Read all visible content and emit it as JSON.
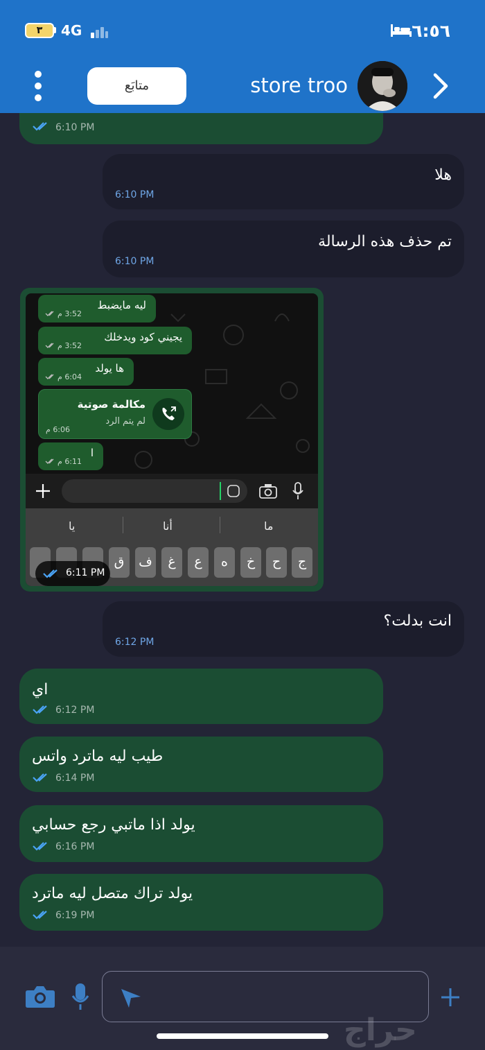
{
  "status_bar": {
    "time": "٦:٥٦",
    "network": "4G",
    "battery": "٣"
  },
  "header": {
    "follow_label": "متابَع",
    "contact_name": "store troo"
  },
  "messages": [
    {
      "dir": "out",
      "text": "",
      "time": "6:10 PM"
    },
    {
      "dir": "in",
      "text": "هلا",
      "time": "6:10 PM"
    },
    {
      "dir": "in",
      "text": "تم حذف هذه الرسالة",
      "time": "6:10 PM"
    },
    {
      "dir": "in",
      "text": "انت بدلت؟",
      "time": "6:12 PM"
    },
    {
      "dir": "out",
      "text": "اي",
      "time": "6:12 PM"
    },
    {
      "dir": "out",
      "text": "طيب ليه ماترد واتس",
      "time": "6:14 PM"
    },
    {
      "dir": "out",
      "text": "يولد اذا ماتبي رجع حسابي",
      "time": "6:16 PM"
    },
    {
      "dir": "out",
      "text": "يولد تراك متصل ليه ماترد",
      "time": "6:19 PM"
    }
  ],
  "image_message": {
    "time": "6:11 PM",
    "screenshot": {
      "messages": [
        {
          "text": "ليه مايضبط",
          "time": "3:52 م"
        },
        {
          "text": "يجيني كود ويدخلك",
          "time": "3:52 م"
        },
        {
          "text": "ها يولد",
          "time": "6:04 م"
        },
        {
          "text": "ا",
          "time": "6:11 م"
        }
      ],
      "call": {
        "title": "مكالمة صوتية",
        "subtitle": "لم يتم الرد",
        "time": "6:06 م"
      },
      "suggestions": [
        "ما",
        "أنا",
        "يا"
      ],
      "keys": [
        "ج",
        "ح",
        "خ",
        "ه",
        "ع",
        "غ",
        "ف",
        "ق"
      ]
    }
  },
  "watermark": "حراج",
  "colors": {
    "header": "#1f73c9",
    "background": "#232436",
    "incoming": "#1c1d2c",
    "outgoing": "#1b4d33",
    "tick": "#4aa3f5"
  }
}
